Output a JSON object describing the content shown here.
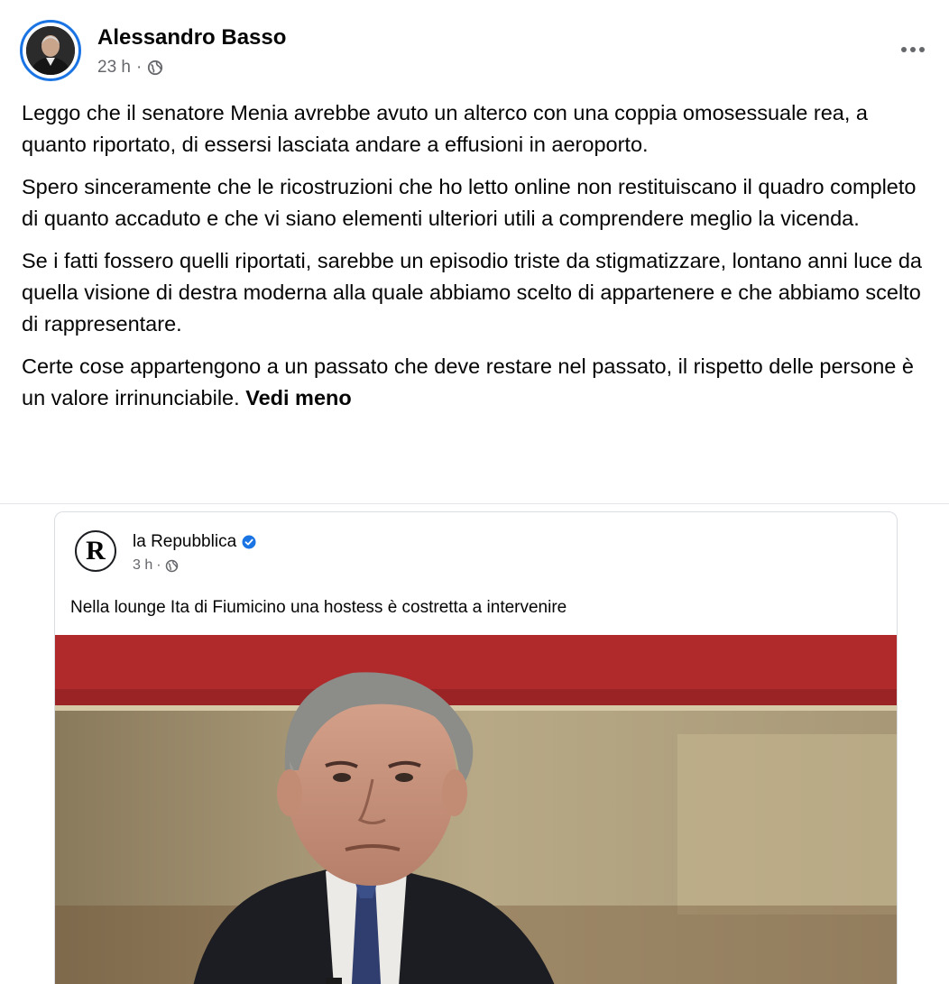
{
  "post": {
    "author": "Alessandro Basso",
    "time": "23 h",
    "separator": "·",
    "paragraphs": [
      "Leggo che il senatore Menia avrebbe avuto un alterco con una coppia omosessuale rea, a quanto riportato, di essersi lasciata andare a effusioni in aeroporto.",
      "Spero sinceramente che le ricostruzioni che ho letto online non restituiscano il quadro completo di quanto accaduto e che vi siano elementi ulteriori utili a comprendere meglio la vicenda.",
      "Se i fatti fossero quelli riportati, sarebbe un episodio triste da stigmatizzare, lontano anni luce da quella visione di destra moderna alla quale abbiamo scelto di appartenere e che abbiamo scelto di rappresentare.",
      "Certe cose appartengono a un passato che deve restare nel passato, il rispetto delle persone è un valore irrinunciabile."
    ],
    "see_less": "Vedi meno"
  },
  "shared": {
    "logo_letter": "R",
    "page_name": "la Repubblica",
    "time": "3 h",
    "separator": "·",
    "text": "Nella lounge Ita di Fiumicino una hostess è costretta a intervenire"
  },
  "icons": {
    "privacy": "globe-icon",
    "verified": "verified-badge-icon",
    "menu": "more-options-icon"
  },
  "colors": {
    "accent": "#1b74e4",
    "secondary_text": "#65676b",
    "divider": "#e4e6eb"
  }
}
